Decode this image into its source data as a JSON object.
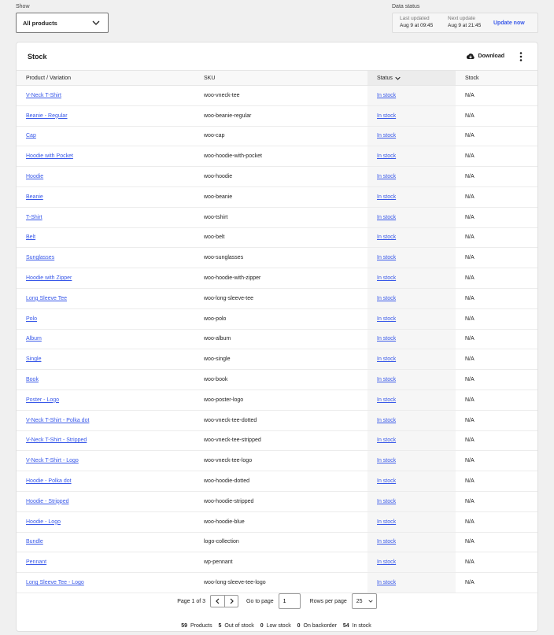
{
  "filter": {
    "label": "Show",
    "value": "All products"
  },
  "data_status": {
    "label": "Data status",
    "last_updated_label": "Last updated",
    "last_updated_value": "Aug 9 at 09:45",
    "next_update_label": "Next update",
    "next_update_value": "Aug 9 at 21:45",
    "update_button": "Update now"
  },
  "table": {
    "title": "Stock",
    "download_label": "Download",
    "columns": [
      "Product / Variation",
      "SKU",
      "Status",
      "Stock"
    ],
    "rows": [
      {
        "product": "V-Neck T-Shirt",
        "sku": "woo-vneck-tee",
        "status": "In stock",
        "stock": "N/A"
      },
      {
        "product": "Beanie - Regular",
        "sku": "woo-beanie-regular",
        "status": "In stock",
        "stock": "N/A"
      },
      {
        "product": "Cap",
        "sku": "woo-cap",
        "status": "In stock",
        "stock": "N/A"
      },
      {
        "product": "Hoodie with Pocket",
        "sku": "woo-hoodie-with-pocket",
        "status": "In stock",
        "stock": "N/A"
      },
      {
        "product": "Hoodie",
        "sku": "woo-hoodie",
        "status": "In stock",
        "stock": "N/A"
      },
      {
        "product": "Beanie",
        "sku": "woo-beanie",
        "status": "In stock",
        "stock": "N/A"
      },
      {
        "product": "T-Shirt",
        "sku": "woo-tshirt",
        "status": "In stock",
        "stock": "N/A"
      },
      {
        "product": "Belt",
        "sku": "woo-belt",
        "status": "In stock",
        "stock": "N/A"
      },
      {
        "product": "Sunglasses",
        "sku": "woo-sunglasses",
        "status": "In stock",
        "stock": "N/A"
      },
      {
        "product": "Hoodie with Zipper",
        "sku": "woo-hoodie-with-zipper",
        "status": "In stock",
        "stock": "N/A"
      },
      {
        "product": "Long Sleeve Tee",
        "sku": "woo-long-sleeve-tee",
        "status": "In stock",
        "stock": "N/A"
      },
      {
        "product": "Polo",
        "sku": "woo-polo",
        "status": "In stock",
        "stock": "N/A"
      },
      {
        "product": "Album",
        "sku": "woo-album",
        "status": "In stock",
        "stock": "N/A"
      },
      {
        "product": "Single",
        "sku": "woo-single",
        "status": "In stock",
        "stock": "N/A"
      },
      {
        "product": "Book",
        "sku": "woo-book",
        "status": "In stock",
        "stock": "N/A"
      },
      {
        "product": "Poster - Logo",
        "sku": "woo-poster-logo",
        "status": "In stock",
        "stock": "N/A"
      },
      {
        "product": "V-Neck T-Shirt - Polka dot",
        "sku": "woo-vneck-tee-dotted",
        "status": "In stock",
        "stock": "N/A"
      },
      {
        "product": "V-Neck T-Shirt - Stripped",
        "sku": "woo-vneck-tee-stripped",
        "status": "In stock",
        "stock": "N/A"
      },
      {
        "product": "V-Neck T-Shirt - Logo",
        "sku": "woo-vneck-tee-logo",
        "status": "In stock",
        "stock": "N/A"
      },
      {
        "product": "Hoodie - Polka dot",
        "sku": "woo-hoodie-dotted",
        "status": "In stock",
        "stock": "N/A"
      },
      {
        "product": "Hoodie - Stripped",
        "sku": "woo-hoodie-stripped",
        "status": "In stock",
        "stock": "N/A"
      },
      {
        "product": "Hoodie - Logo",
        "sku": "woo-hoodie-blue",
        "status": "In stock",
        "stock": "N/A"
      },
      {
        "product": "Bundle",
        "sku": "logo-collection",
        "status": "In stock",
        "stock": "N/A"
      },
      {
        "product": "Pennant",
        "sku": "wp-pennant",
        "status": "In stock",
        "stock": "N/A"
      },
      {
        "product": "Long Sleeve Tee - Logo",
        "sku": "woo-long-sleeve-tee-logo",
        "status": "In stock",
        "stock": "N/A"
      }
    ]
  },
  "pagination": {
    "page_info": "Page 1 of 3",
    "goto_label": "Go to page",
    "goto_value": "1",
    "rows_label": "Rows per page",
    "rows_value": "25"
  },
  "summary": [
    {
      "count": "59",
      "label": "Products"
    },
    {
      "count": "5",
      "label": "Out of stock"
    },
    {
      "count": "0",
      "label": "Low stock"
    },
    {
      "count": "0",
      "label": "On backorder"
    },
    {
      "count": "54",
      "label": "In stock"
    }
  ],
  "colors": {
    "accent": "#3858e9",
    "background": "#f0f0f0"
  },
  "icons": {
    "download": "cloud-download-icon",
    "menu": "kebab-menu-icon",
    "sort": "chevron-down-icon"
  }
}
